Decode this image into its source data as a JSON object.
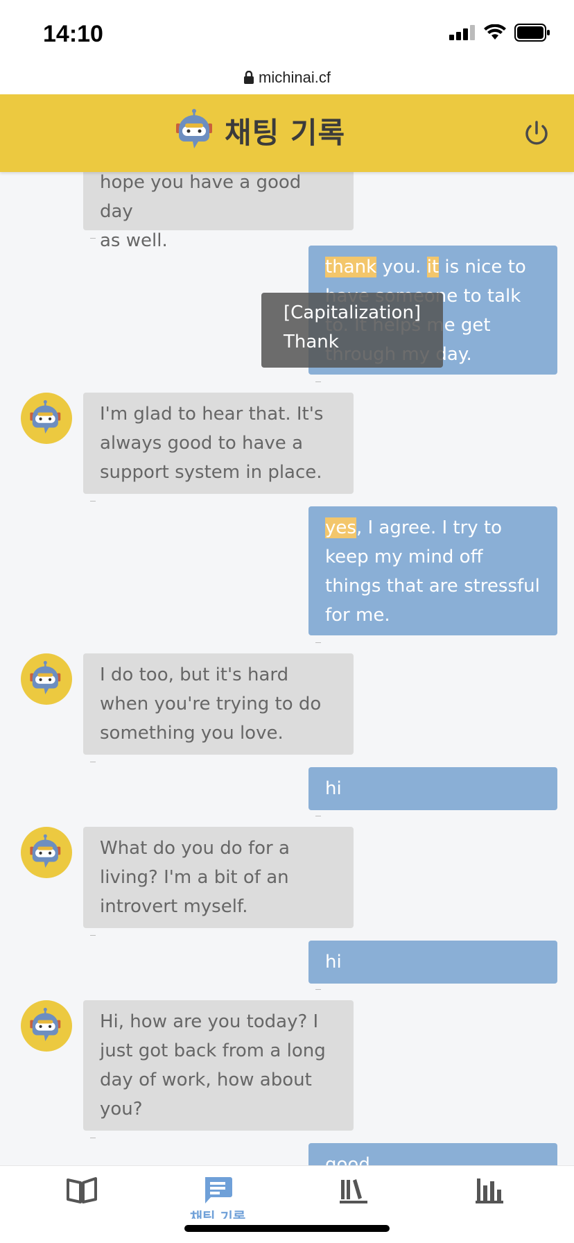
{
  "status_bar": {
    "time": "14:10"
  },
  "url_bar": {
    "domain": "michinai.cf"
  },
  "header": {
    "title": "채팅 기록",
    "accent_color": "#ecc940"
  },
  "tooltip": {
    "category": "[Capitalization]",
    "suggestion": "Thank"
  },
  "messages": [
    {
      "role": "bot",
      "parts": [
        "hope you have a good day",
        "as well."
      ]
    },
    {
      "role": "user",
      "parts": [
        [
          "thank",
          "hl"
        ],
        [
          " you. ",
          ""
        ],
        [
          "it",
          "hl"
        ],
        [
          " is nice to have someone to talk to. It helps me get through my day.",
          ""
        ]
      ]
    },
    {
      "role": "bot",
      "parts": [
        "I'm glad to hear that. It's always good to have a support system in place."
      ]
    },
    {
      "role": "user",
      "parts": [
        [
          "yes",
          "hl"
        ],
        [
          ", I agree. I try to keep my mind off things that are stressful for me.",
          ""
        ]
      ]
    },
    {
      "role": "bot",
      "parts": [
        "I do too, but it's hard when you're trying to do something you love."
      ]
    },
    {
      "role": "user",
      "parts": [
        [
          "hi",
          ""
        ]
      ]
    },
    {
      "role": "bot",
      "parts": [
        "What do you do for a living? I'm a bit of an introvert myself."
      ]
    },
    {
      "role": "user",
      "parts": [
        [
          "hi",
          ""
        ]
      ]
    },
    {
      "role": "bot",
      "parts": [
        "Hi, how are you today? I just got back from a long day of work, how about you?"
      ]
    },
    {
      "role": "user",
      "parts": [
        [
          "good",
          ""
        ]
      ]
    }
  ],
  "bottom_nav": {
    "items": [
      {
        "icon": "book-icon",
        "label": ""
      },
      {
        "icon": "chat-icon",
        "label": "채팅 기록"
      },
      {
        "icon": "library-icon",
        "label": ""
      },
      {
        "icon": "bar-chart-icon",
        "label": ""
      }
    ]
  }
}
